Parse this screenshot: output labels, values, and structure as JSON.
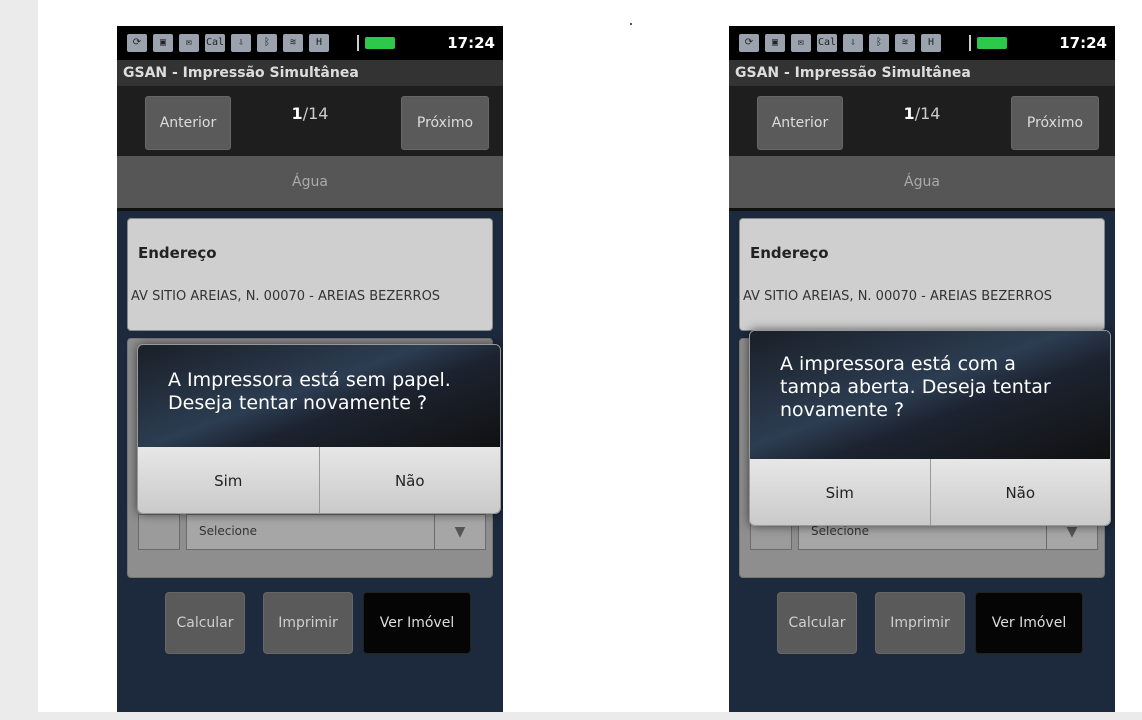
{
  "app_title": "GSAN - Impressão Simultânea",
  "status_time": "17:24",
  "status_icons": [
    "sync-icon",
    "image-icon",
    "mail-icon",
    "calendar-icon",
    "usb-icon",
    "bluetooth-icon",
    "vibrate-icon",
    "h-icon",
    "signal-icon",
    "battery-icon"
  ],
  "status_cal_text": "Cal",
  "status_h_text": "H",
  "nav": {
    "prev": "Anterior",
    "next": "Próximo",
    "counter_current": "1",
    "counter_total": "/14"
  },
  "section_tab": "Água",
  "address": {
    "title": "Endereço",
    "value": "AV SITIO AREIAS, N. 00070 - AREIAS BEZERROS"
  },
  "select": {
    "label": "Selecione"
  },
  "actions": {
    "calcular": "Calcular",
    "imprimir": "Imprimir",
    "ver_imovel": "Ver Imóvel"
  },
  "dialogs": {
    "left": {
      "lines": [
        "A Impressora está sem papel.",
        "Deseja tentar novamente ?"
      ],
      "yes": "Sim",
      "no": "Não"
    },
    "right": {
      "lines": [
        "A impressora está com a",
        "tampa aberta. Deseja tentar",
        "novamente ?"
      ],
      "yes": "Sim",
      "no": "Não"
    }
  },
  "colors": {
    "battery": "#2cc94b",
    "app_bg": "#1d2a3d"
  }
}
